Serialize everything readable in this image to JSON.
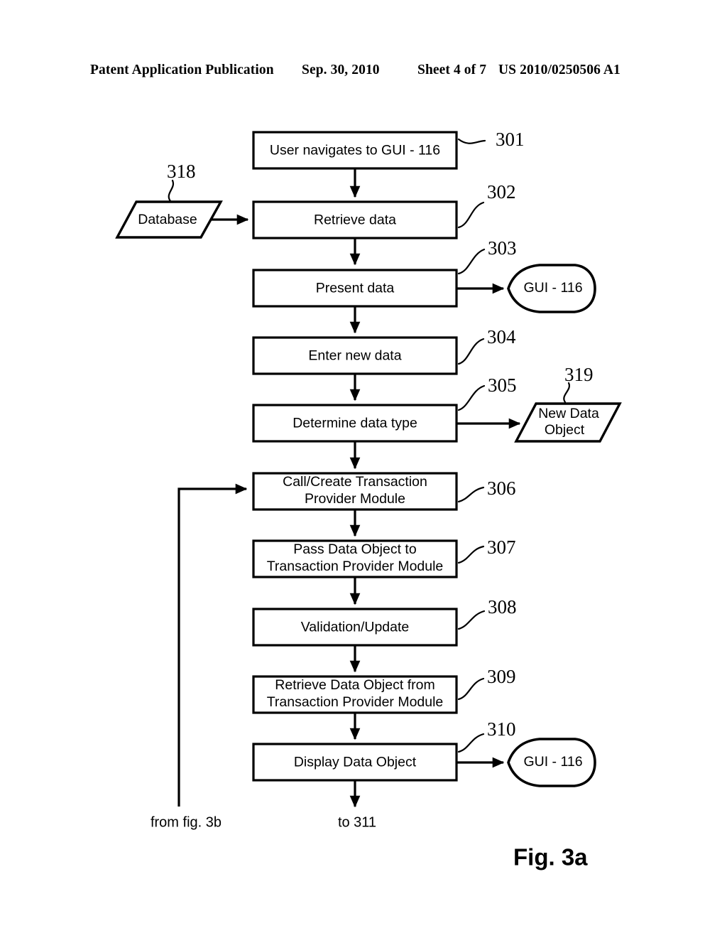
{
  "header": {
    "publication": "Patent Application Publication",
    "date": "Sep. 30, 2010",
    "sheet": "Sheet 4 of 7",
    "patent_number": "US 2010/0250506 A1"
  },
  "figure": {
    "caption": "Fig. 3a",
    "entry_label": "from fig. 3b",
    "exit_label": "to 311"
  },
  "nodes": {
    "n301": {
      "label": "User navigates to GUI - 116",
      "ref": "301"
    },
    "n302": {
      "label": "Retrieve data",
      "ref": "302"
    },
    "n303": {
      "label": "Present data",
      "ref": "303"
    },
    "n304": {
      "label": "Enter new data",
      "ref": "304"
    },
    "n305": {
      "label": "Determine data type",
      "ref": "305"
    },
    "n306": {
      "label_line1": "Call/Create Transaction",
      "label_line2": "Provider Module",
      "ref": "306"
    },
    "n307": {
      "label_line1": "Pass Data Object to",
      "label_line2": "Transaction Provider Module",
      "ref": "307"
    },
    "n308": {
      "label": "Validation/Update",
      "ref": "308"
    },
    "n309": {
      "label_line1": "Retrieve Data Object from",
      "label_line2": "Transaction Provider Module",
      "ref": "309"
    },
    "n310": {
      "label": "Display Data Object",
      "ref": "310"
    },
    "n318": {
      "label": "Database",
      "ref": "318"
    },
    "n319": {
      "label_line1": "New Data",
      "label_line2": "Object",
      "ref": "319"
    },
    "gui_top": {
      "label": "GUI - 116"
    },
    "gui_bottom": {
      "label": "GUI - 116"
    }
  },
  "colors": {
    "ink": "#000000",
    "paper": "#ffffff"
  }
}
